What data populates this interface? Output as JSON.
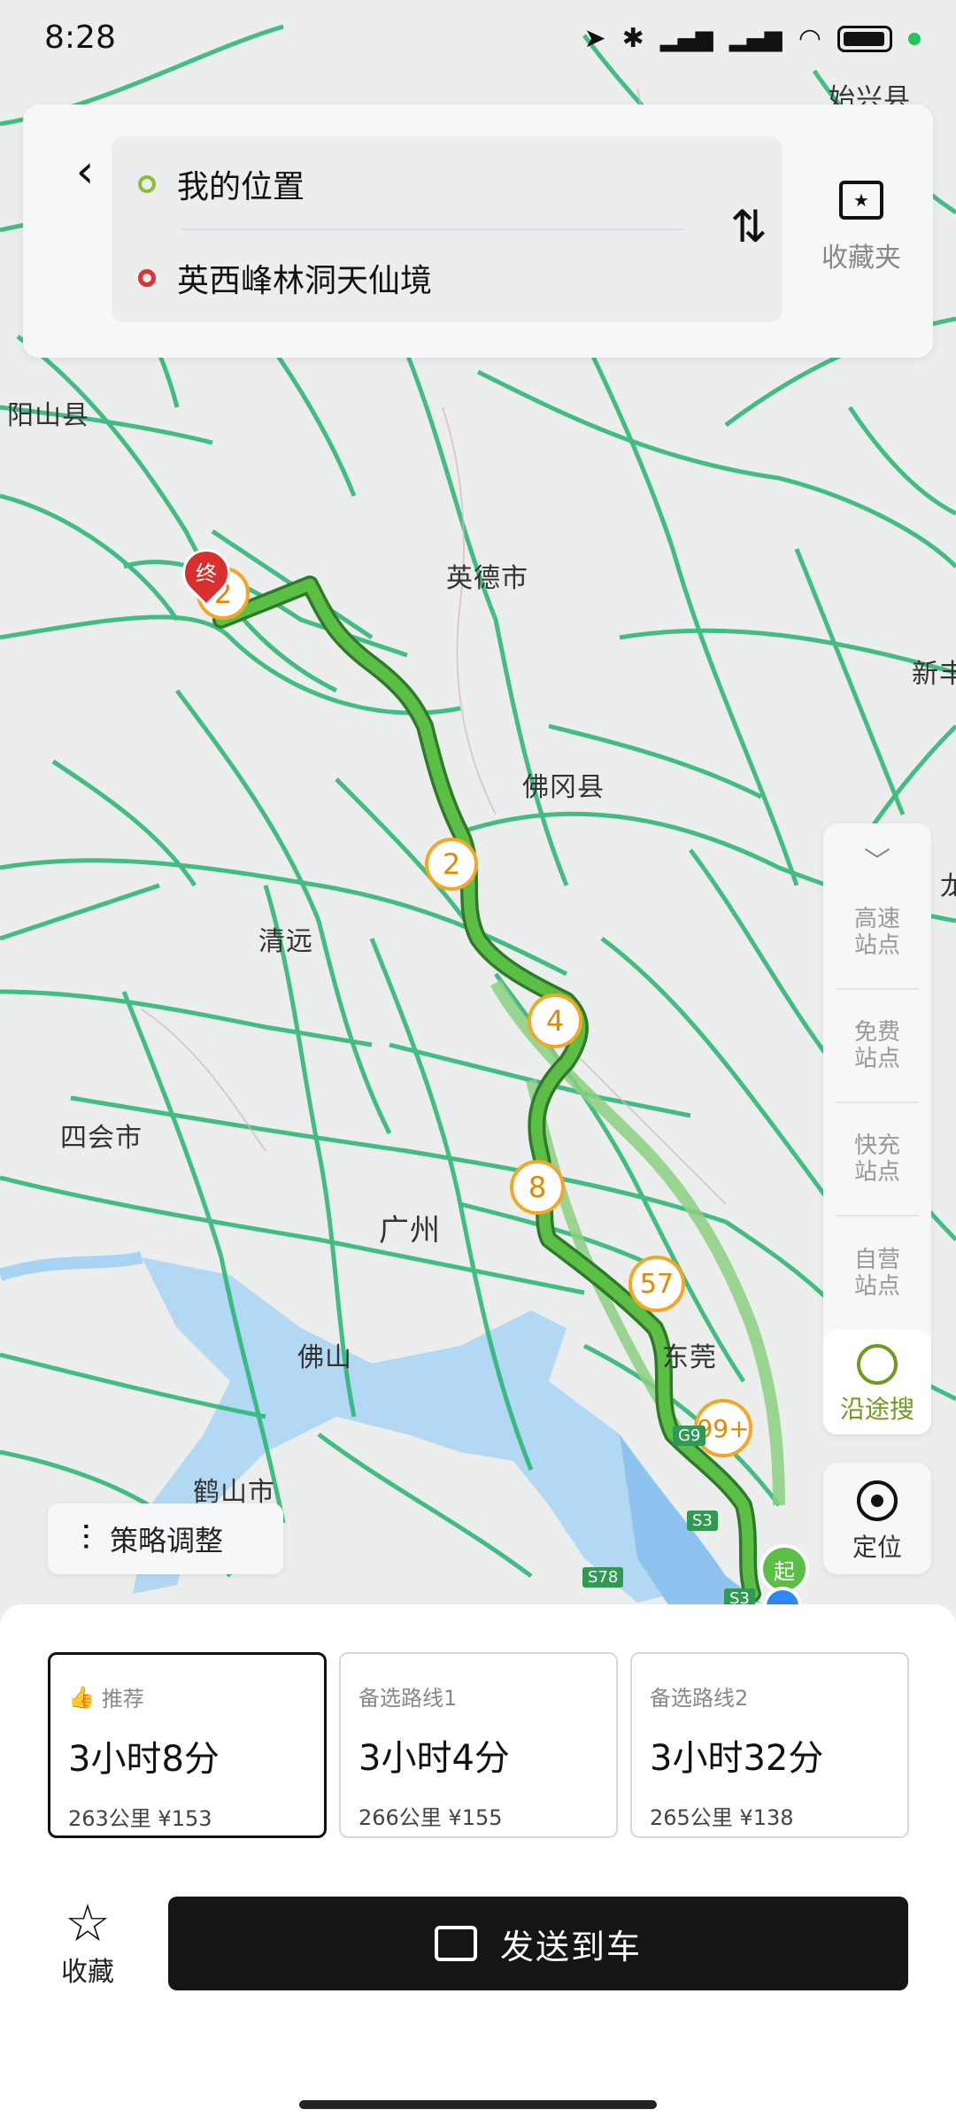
{
  "status_bar": {
    "time": "8:28",
    "icons": [
      "location-arrow-icon",
      "bluetooth-icon",
      "signal-hd-icon",
      "signal-hd-icon",
      "wifi-icon",
      "battery-icon"
    ]
  },
  "route": {
    "from": "我的位置",
    "to": "英西峰林洞天仙境",
    "favorites_folder": "收藏夹"
  },
  "map": {
    "labels": [
      "始兴县",
      "阳山县",
      "英德市",
      "新丰",
      "佛冈县",
      "清远",
      "龙",
      "四会市",
      "广州",
      "佛山",
      "东莞",
      "鹤山市"
    ],
    "route_markers": [
      "2",
      "4",
      "8",
      "57",
      "99+",
      "2"
    ],
    "road_shields": [
      "G9",
      "S3",
      "S3",
      "S78"
    ],
    "start_marker": "起",
    "end_marker": "终",
    "colors": {
      "route": "#3fa63a",
      "alt_route": "#8ccf80",
      "roads": "#25b570",
      "water": "#a9d3f5"
    }
  },
  "side_panel": {
    "items": [
      "高速站点",
      "免费站点",
      "快充站点",
      "自营站点"
    ],
    "search_label": "沿途搜",
    "locate_label": "定位"
  },
  "strategy_label": "策略调整",
  "route_options": [
    {
      "tag": "推荐",
      "time": "3小时8分",
      "meta": "263公里 ¥153",
      "selected": true
    },
    {
      "tag": "备选路线1",
      "time": "3小时4分",
      "meta": "266公里 ¥155",
      "selected": false
    },
    {
      "tag": "备选路线2",
      "time": "3小时32分",
      "meta": "265公里 ¥138",
      "selected": false
    }
  ],
  "actions": {
    "favorite_label": "收藏",
    "send_label": "发送到车"
  }
}
